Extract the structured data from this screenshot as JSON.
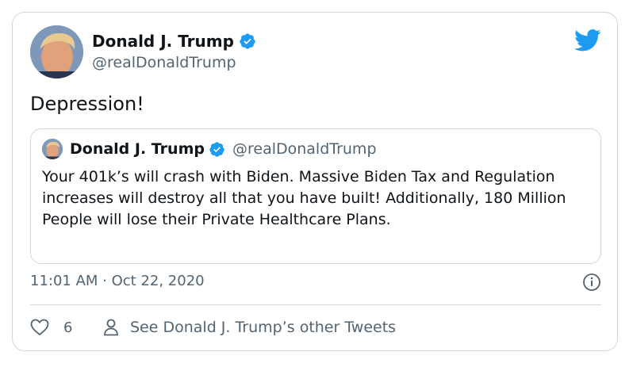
{
  "tweet": {
    "author_name": "Donald J. Trump",
    "author_handle": "@realDonaldTrump",
    "text": "Depression!",
    "timestamp": "11:01 AM · Oct 22, 2020",
    "likes": "6",
    "other_tweets_link": "See Donald J. Trump’s other Tweets"
  },
  "quoted_tweet": {
    "author_name": "Donald J. Trump",
    "author_handle": "@realDonaldTrump",
    "text": "Your 401k’s will crash with Biden. Massive Biden Tax and Regulation increases will destroy all that you have built! Additionally, 180 Million People will lose their Private Healthcare Plans."
  },
  "colors": {
    "brand_blue": "#1d9bf0",
    "text_primary": "#0f1419",
    "text_secondary": "#536471",
    "border": "#cfd9de"
  },
  "icons": [
    "twitter-bird-icon",
    "verified-badge-icon",
    "info-icon",
    "heart-icon",
    "person-icon"
  ]
}
